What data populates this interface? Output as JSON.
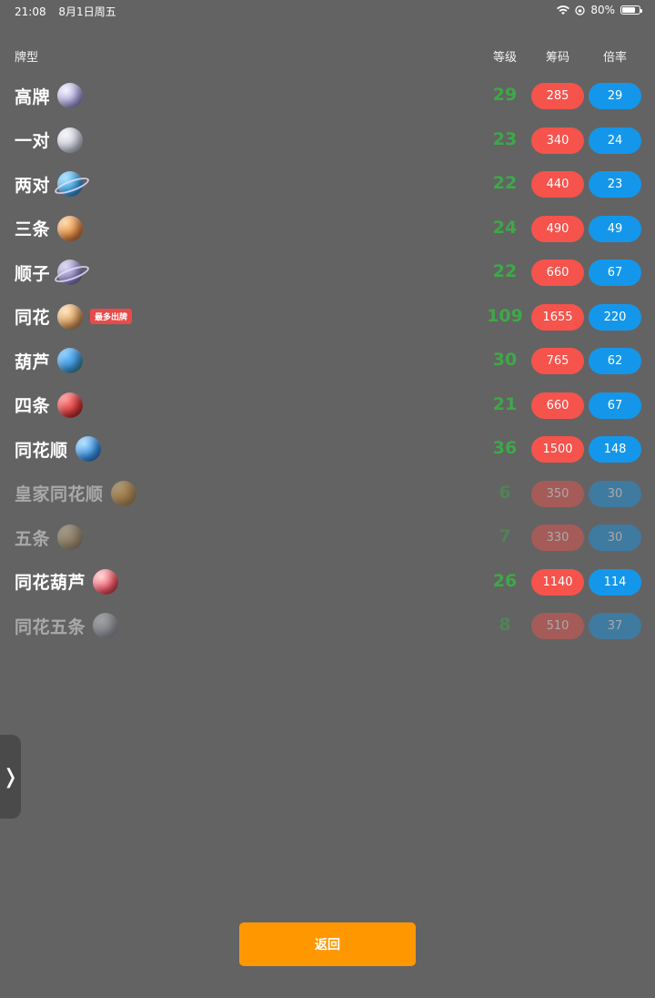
{
  "status_bar": {
    "time": "21:08",
    "date": "8月1日周五",
    "battery": "80%",
    "battery_level": 0.8
  },
  "header": {
    "name": "牌型",
    "level": "等级",
    "chips": "筹码",
    "mult": "倍率"
  },
  "rows": [
    {
      "name": "高牌",
      "level": "29",
      "chips": "285",
      "mult": "29",
      "planet": "planet-icon",
      "dim": false,
      "colors": [
        "#f2f2ff",
        "#a9a4d8",
        "#5f5aa0"
      ]
    },
    {
      "name": "一对",
      "level": "23",
      "chips": "340",
      "mult": "24",
      "planet": "planet-icon",
      "dim": false,
      "colors": [
        "#f4f4f8",
        "#c9cbd8",
        "#8a8ea4"
      ]
    },
    {
      "name": "两对",
      "level": "22",
      "chips": "440",
      "mult": "23",
      "planet": "ringed-planet-icon",
      "dim": false,
      "colors": [
        "#9fe0ff",
        "#3aa0dc",
        "#1a5f9c"
      ]
    },
    {
      "name": "三条",
      "level": "24",
      "chips": "490",
      "mult": "49",
      "planet": "planet-icon",
      "dim": false,
      "colors": [
        "#ffd39a",
        "#e08a45",
        "#9a4a1e"
      ]
    },
    {
      "name": "顺子",
      "level": "22",
      "chips": "660",
      "mult": "67",
      "planet": "ringed-planet-icon",
      "dim": false,
      "colors": [
        "#d8d4f0",
        "#8f86c0",
        "#55487e"
      ]
    },
    {
      "name": "同花",
      "level": "109",
      "chips": "1655",
      "mult": "220",
      "planet": "planet-icon",
      "dim": false,
      "colors": [
        "#ffe0b0",
        "#d69a60",
        "#8a5a2e"
      ],
      "tag": "最多出牌"
    },
    {
      "name": "葫芦",
      "level": "30",
      "chips": "765",
      "mult": "62",
      "planet": "earth-icon",
      "dim": false,
      "colors": [
        "#6ec3ff",
        "#3b8fd6",
        "#2f7a3a"
      ]
    },
    {
      "name": "四条",
      "level": "21",
      "chips": "660",
      "mult": "67",
      "planet": "planet-icon",
      "dim": false,
      "colors": [
        "#ff8a8a",
        "#d63a3a",
        "#7a1414"
      ]
    },
    {
      "name": "同花顺",
      "level": "36",
      "chips": "1500",
      "mult": "148",
      "planet": "planet-icon",
      "dim": false,
      "colors": [
        "#a6dcff",
        "#3a8fe0",
        "#1a4f9c"
      ]
    },
    {
      "name": "皇家同花顺",
      "level": "6",
      "chips": "350",
      "mult": "30",
      "planet": "planet-icon",
      "dim": true,
      "colors": [
        "#ffcf6a",
        "#e08a1a",
        "#8a4a0a"
      ]
    },
    {
      "name": "五条",
      "level": "7",
      "chips": "330",
      "mult": "30",
      "planet": "planet-icon",
      "dim": true,
      "colors": [
        "#e8d2a0",
        "#b8925a",
        "#6e542e"
      ]
    },
    {
      "name": "同花葫芦",
      "level": "26",
      "chips": "1140",
      "mult": "114",
      "planet": "planet-icon",
      "dim": false,
      "colors": [
        "#ffd0d0",
        "#f05a6a",
        "#9a1a2a"
      ]
    },
    {
      "name": "同花五条",
      "level": "8",
      "chips": "510",
      "mult": "37",
      "planet": "planet-icon",
      "dim": true,
      "colors": [
        "#e8eaf0",
        "#a0a8b8",
        "#5a6070"
      ]
    }
  ],
  "side_tab": {
    "label": "❭"
  },
  "back_button": {
    "label": "返回"
  },
  "colors": {
    "background": "#636363",
    "level": "#3ea848",
    "chips": "#f5534c",
    "mult": "#1497ea",
    "button": "#ff9800"
  }
}
